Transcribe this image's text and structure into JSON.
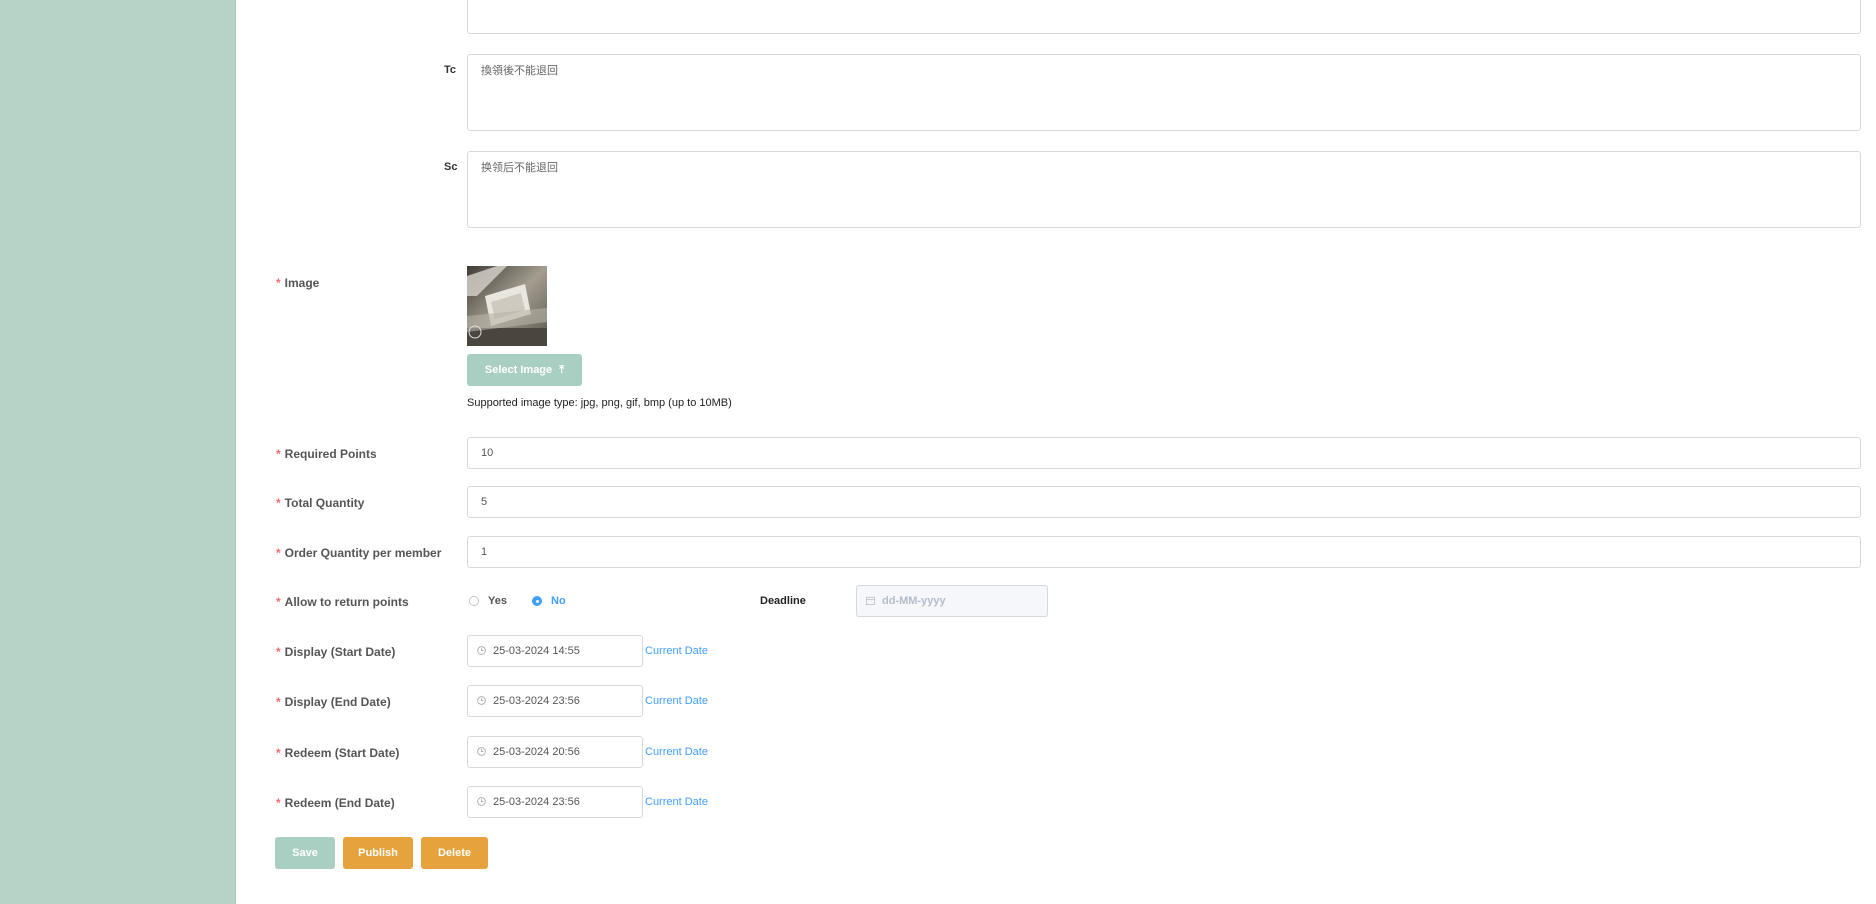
{
  "translations": {
    "tc_label": "Tc",
    "tc_value": "換領後不能退回",
    "sc_label": "Sc",
    "sc_value": "换领后不能退回"
  },
  "image": {
    "label": "Image",
    "select_button": "Select Image",
    "upload_icon": "upload-icon",
    "hint": "Supported image type: jpg, png, gif, bmp (up to 10MB)"
  },
  "fields": {
    "required_points": {
      "label": "Required Points",
      "value": "10"
    },
    "total_quantity": {
      "label": "Total Quantity",
      "value": "5"
    },
    "order_quantity": {
      "label": "Order Quantity per member",
      "value": "1"
    }
  },
  "return_points": {
    "label": "Allow to return points",
    "yes": "Yes",
    "no": "No",
    "selected": "No",
    "deadline_label": "Deadline",
    "deadline_placeholder": "dd-MM-yyyy"
  },
  "dates": {
    "current_date_link": "Current Date",
    "display_start": {
      "label": "Display (Start Date)",
      "value": "25-03-2024 14:55"
    },
    "display_end": {
      "label": "Display (End Date)",
      "value": "25-03-2024 23:56"
    },
    "redeem_start": {
      "label": "Redeem (Start Date)",
      "value": "25-03-2024 20:56"
    },
    "redeem_end": {
      "label": "Redeem (End Date)",
      "value": "25-03-2024 23:56"
    }
  },
  "actions": {
    "save": "Save",
    "publish": "Publish",
    "delete": "Delete"
  },
  "colors": {
    "sidebar": "#b6d3c8",
    "primary_disabled": "#a8cfc1",
    "warning": "#e6a23c",
    "link": "#409eff",
    "required": "#f56c6c"
  }
}
